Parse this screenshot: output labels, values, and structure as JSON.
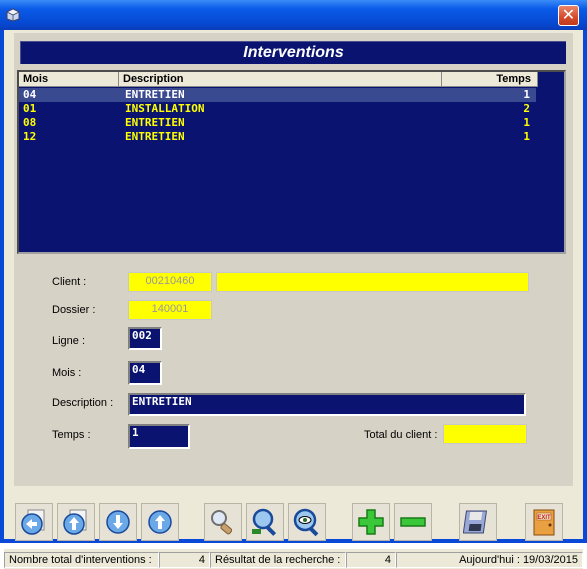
{
  "window": {
    "title": "",
    "close_glyph": "✕"
  },
  "header": {
    "title": "Interventions"
  },
  "grid": {
    "columns": {
      "mois": "Mois",
      "description": "Description",
      "temps": "Temps"
    },
    "rows": [
      {
        "mois": "04",
        "description": "ENTRETIEN",
        "temps": "1"
      },
      {
        "mois": "01",
        "description": "INSTALLATION",
        "temps": "2"
      },
      {
        "mois": "08",
        "description": "ENTRETIEN",
        "temps": "1"
      },
      {
        "mois": "12",
        "description": "ENTRETIEN",
        "temps": "1"
      }
    ],
    "selected_index": 0
  },
  "form": {
    "client_label": "Client :",
    "client_code": "00210460",
    "client_name": "",
    "dossier_label": "Dossier :",
    "dossier_value": "140001",
    "ligne_label": "Ligne :",
    "ligne_value": "002",
    "mois_label": "Mois :",
    "mois_value": "04",
    "description_label": "Description :",
    "description_value": "ENTRETIEN",
    "temps_label": "Temps :",
    "temps_value": "1",
    "total_label": "Total du client :",
    "total_value": ""
  },
  "toolbar": {
    "buttons": [
      "first-record-icon",
      "previous-record-icon",
      "next-record-icon",
      "last-record-icon",
      "search-icon",
      "zoom-search-icon",
      "view-eye-icon",
      "add-plus-icon",
      "remove-minus-icon",
      "save-floppy-icon",
      "exit-door-icon"
    ]
  },
  "status": {
    "total_label": "Nombre total d'interventions :",
    "total_value": "4",
    "result_label": "Résultat de la recherche :",
    "result_value": "4",
    "today": "Aujourd'hui : 19/03/2015"
  },
  "colors": {
    "navy": "#0a1470",
    "yellow": "#ffff00",
    "titlebar": "#0a5ae8",
    "panel": "#d7d2c6"
  }
}
